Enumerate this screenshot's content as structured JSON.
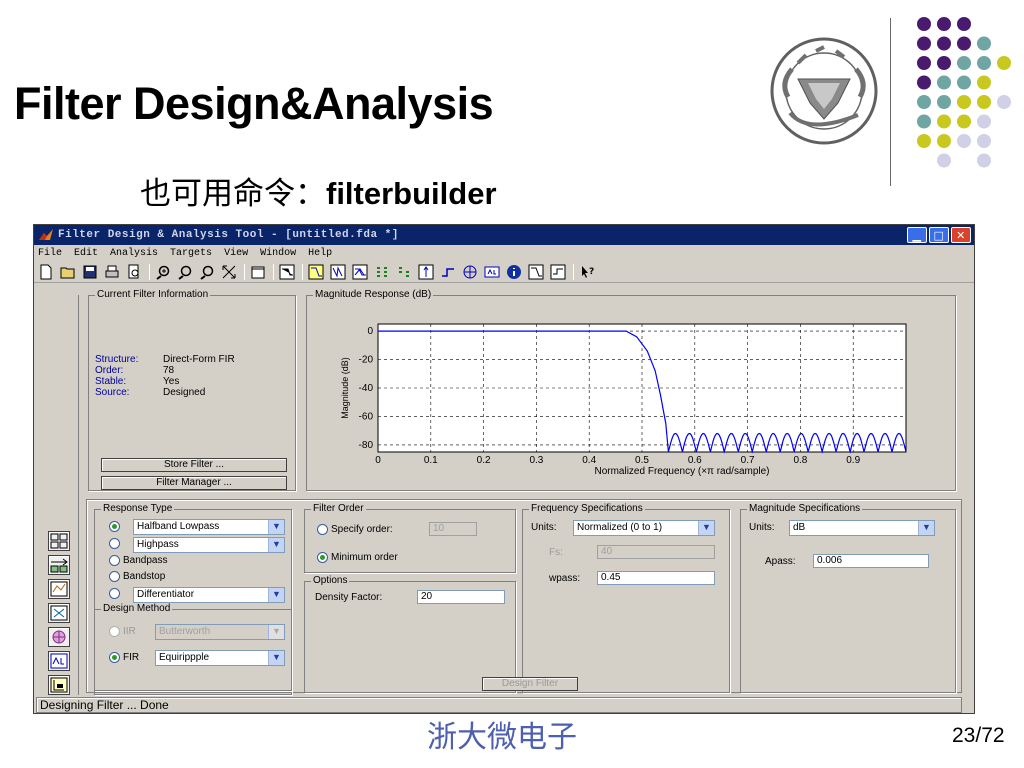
{
  "slide": {
    "title": "Filter Design&Analysis",
    "subtitle_cn": "也可用命令：",
    "subtitle_cmd": "filterbuilder",
    "footer": "浙大微电子",
    "page": "23/72"
  },
  "window": {
    "title": "Filter Design & Analysis Tool -  [untitled.fda *]",
    "menu": [
      "File",
      "Edit",
      "Analysis",
      "Targets",
      "View",
      "Window",
      "Help"
    ],
    "status": "Designing Filter ... Done"
  },
  "current_info": {
    "label": "Current Filter Information",
    "fields": [
      {
        "key": "Structure:",
        "value": "Direct-Form FIR"
      },
      {
        "key": "Order:",
        "value": "78"
      },
      {
        "key": "Stable:",
        "value": "Yes"
      },
      {
        "key": "Source:",
        "value": "Designed"
      }
    ],
    "store_btn": "Store Filter ...",
    "manager_btn": "Filter Manager ..."
  },
  "chart_data": {
    "type": "line",
    "title": "Magnitude Response (dB)",
    "xlabel": "Normalized Frequency (×π rad/sample)",
    "ylabel": "Magnitude (dB)",
    "xlim": [
      0,
      1
    ],
    "ylim": [
      -85,
      5
    ],
    "xticks": [
      "0",
      "0.1",
      "0.2",
      "0.3",
      "0.4",
      "0.5",
      "0.6",
      "0.7",
      "0.8",
      "0.9"
    ],
    "yticks": [
      "0",
      "-20",
      "-40",
      "-60",
      "-80"
    ],
    "grid": true,
    "series": [
      {
        "color": "#0000ff",
        "passband_edge": 0.47,
        "stopband_edge": 0.55,
        "stopband_level": -80,
        "ripple_peak": -72,
        "ripple_lobes": 17,
        "x": [
          0,
          0.47,
          0.49,
          0.51,
          0.525,
          0.535,
          0.545,
          0.55
        ],
        "y": [
          0,
          0,
          -4,
          -14,
          -28,
          -45,
          -65,
          -85
        ]
      }
    ]
  },
  "response_type": {
    "label": "Response Type",
    "options": [
      {
        "label": "Halfband Lowpass",
        "selected": true,
        "combo": true
      },
      {
        "label": "Highpass",
        "selected": false,
        "combo": true
      },
      {
        "label": "Bandpass",
        "selected": false,
        "combo": false
      },
      {
        "label": "Bandstop",
        "selected": false,
        "combo": false
      },
      {
        "label": "Differentiator",
        "selected": false,
        "combo": true
      }
    ]
  },
  "design_method": {
    "label": "Design Method",
    "iir_label": "IIR",
    "iir_value": "Butterworth",
    "fir_label": "FIR",
    "fir_value": "Equirippple"
  },
  "filter_order": {
    "label": "Filter Order",
    "specify_label": "Specify order:",
    "specify_value": "10",
    "minimum_label": "Minimum order"
  },
  "options": {
    "label": "Options",
    "density_label": "Density Factor:",
    "density_value": "20"
  },
  "freq_spec": {
    "label": "Frequency Specifications",
    "units_label": "Units:",
    "units_value": "Normalized (0 to 1)",
    "fs_label": "Fs:",
    "fs_value": "40",
    "wpass_label": "wpass:",
    "wpass_value": "0.45"
  },
  "mag_spec": {
    "label": "Magnitude Specifications",
    "units_label": "Units:",
    "units_value": "dB",
    "apass_label": "Apass:",
    "apass_value": "0.006"
  },
  "design_button": "Design Filter"
}
